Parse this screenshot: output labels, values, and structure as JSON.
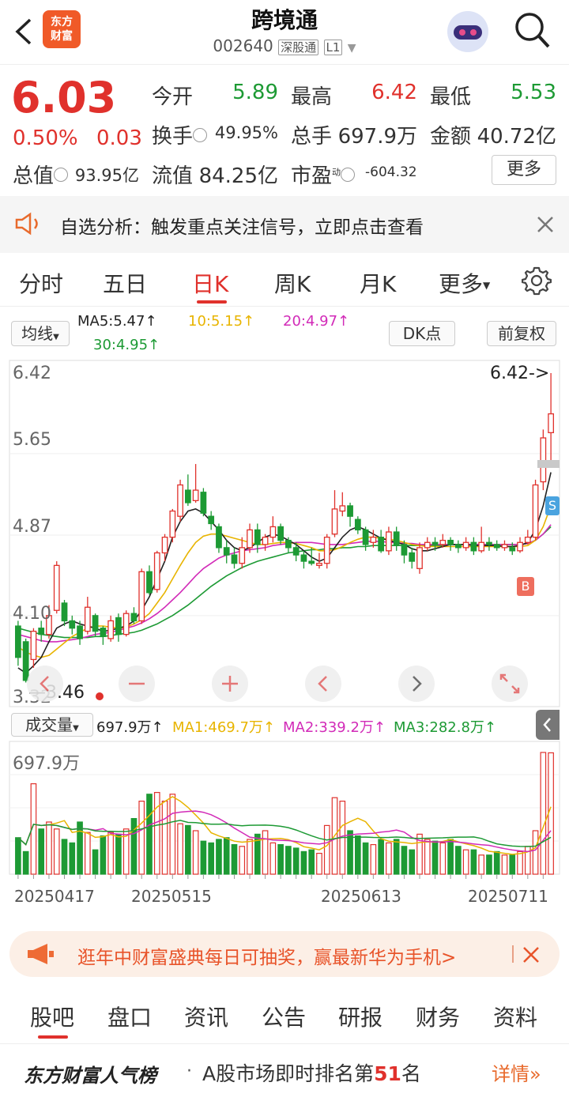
{
  "header": {
    "title": "跨境通",
    "code": "002640",
    "market_tag": "深股通",
    "level_tag": "L1",
    "logo_line1": "东方",
    "logo_line2": "财富"
  },
  "quote": {
    "price": "6.03",
    "change_pct": "0.50%",
    "change": "0.03",
    "open_label": "今开",
    "open": "5.89",
    "high_label": "最高",
    "high": "6.42",
    "low_label": "最低",
    "low": "5.53",
    "turnover_label": "换手",
    "turnover": "49.95%",
    "volume_label": "总手",
    "volume": "697.9万",
    "amount_label": "金额",
    "amount": "40.72亿",
    "mktcap_label": "总值",
    "mktcap": "93.95亿",
    "float_label": "流值",
    "float": "84.25亿",
    "pe_label": "市盈",
    "pe_sup": "动",
    "pe": "-604.32",
    "more_label": "更多"
  },
  "notice": {
    "text": "自选分析：触发重点关注信号，立即点击查看"
  },
  "tabs": {
    "items": [
      "分时",
      "五日",
      "日K",
      "周K",
      "月K",
      "更多"
    ],
    "active": "日K"
  },
  "indicators": {
    "ma_select": "均线",
    "ma5": "MA5:5.47↑",
    "ma10": "10:5.15↑",
    "ma20": "20:4.97↑",
    "ma30": "30:4.95↑",
    "dk_label": "DK点",
    "adjust_label": "前复权"
  },
  "chart_labels": {
    "y_ticks": [
      "6.42",
      "5.65",
      "4.87",
      "4.10",
      "3.32"
    ],
    "max_marker": "6.42->",
    "min_marker": "3.46",
    "buy_marker": "B",
    "sell_marker": "S",
    "vol_select": "成交量",
    "vol_value": "697.9万↑",
    "vol_ma1": "MA1:469.7万↑",
    "vol_ma2": "MA2:339.2万↑",
    "vol_ma3": "MA3:282.8万↑",
    "vol_max": "697.9万",
    "dates": [
      "20250417",
      "20250515",
      "20250613",
      "20250711"
    ]
  },
  "colors": {
    "up": "#e0312c",
    "down": "#1d9a34",
    "ma5": "#222222",
    "ma10": "#e8b400",
    "ma20": "#d22bb8",
    "ma30": "#1d9a34",
    "accent": "#e0312c"
  },
  "promo": {
    "text": "逛年中财富盛典每日可抽奖，赢最新华为手机>"
  },
  "bottom_tabs": {
    "items": [
      "股吧",
      "盘口",
      "资讯",
      "公告",
      "研报",
      "财务",
      "资料"
    ],
    "active": "股吧"
  },
  "rank": {
    "brand": "东方财富人气榜",
    "text_prefix": "A股市场即时排名第",
    "rank_no": "51",
    "text_suffix": "名",
    "detail": "详情"
  },
  "chart_data": {
    "type": "candlestick",
    "y_range": [
      3.32,
      6.42
    ],
    "candles": [
      [
        4.0,
        3.7,
        4.05,
        3.62
      ],
      [
        3.85,
        3.48,
        3.88,
        3.46
      ],
      [
        3.68,
        3.95,
        3.98,
        3.6
      ],
      [
        3.98,
        3.92,
        4.05,
        3.85
      ],
      [
        3.92,
        4.1,
        4.2,
        3.88
      ],
      [
        4.15,
        4.58,
        4.62,
        4.12
      ],
      [
        4.22,
        4.05,
        4.25,
        4.0
      ],
      [
        4.05,
        3.98,
        4.1,
        3.92
      ],
      [
        4.0,
        3.88,
        4.05,
        3.82
      ],
      [
        3.95,
        4.18,
        4.28,
        3.92
      ],
      [
        4.1,
        3.95,
        4.12,
        3.9
      ],
      [
        3.98,
        3.9,
        4.0,
        3.82
      ],
      [
        3.88,
        4.05,
        4.1,
        3.85
      ],
      [
        4.08,
        3.92,
        4.12,
        3.85
      ],
      [
        3.92,
        4.12,
        4.15,
        3.9
      ],
      [
        4.12,
        4.05,
        4.18,
        4.02
      ],
      [
        4.05,
        4.52,
        4.55,
        4.02
      ],
      [
        4.52,
        4.32,
        4.58,
        4.3
      ],
      [
        4.35,
        4.7,
        4.72,
        4.32
      ],
      [
        4.7,
        4.85,
        4.88,
        4.62
      ],
      [
        4.85,
        5.1,
        5.12,
        4.8
      ],
      [
        5.05,
        5.35,
        5.4,
        5.0
      ],
      [
        5.3,
        5.18,
        5.45,
        5.15
      ],
      [
        5.2,
        5.3,
        5.55,
        5.18
      ],
      [
        5.28,
        5.08,
        5.32,
        5.05
      ],
      [
        5.05,
        4.98,
        5.1,
        4.92
      ],
      [
        4.95,
        4.75,
        4.98,
        4.7
      ],
      [
        4.75,
        4.68,
        4.82,
        4.6
      ],
      [
        4.68,
        4.6,
        4.75,
        4.55
      ],
      [
        4.6,
        4.75,
        4.85,
        4.55
      ],
      [
        4.75,
        4.92,
        4.98,
        4.7
      ],
      [
        4.92,
        4.78,
        4.98,
        4.7
      ],
      [
        4.78,
        4.85,
        4.88,
        4.72
      ],
      [
        4.85,
        4.95,
        5.05,
        4.8
      ],
      [
        4.95,
        4.82,
        4.98,
        4.78
      ],
      [
        4.82,
        4.75,
        4.85,
        4.7
      ],
      [
        4.75,
        4.68,
        4.8,
        4.62
      ],
      [
        4.68,
        4.62,
        4.72,
        4.55
      ],
      [
        4.62,
        4.6,
        4.75,
        4.58
      ],
      [
        4.58,
        4.6,
        4.7,
        4.55
      ],
      [
        4.6,
        4.85,
        4.88,
        4.55
      ],
      [
        4.88,
        5.12,
        5.3,
        4.85
      ],
      [
        5.1,
        5.15,
        5.28,
        5.05
      ],
      [
        5.15,
        5.05,
        5.18,
        4.95
      ],
      [
        5.02,
        4.92,
        5.05,
        4.88
      ],
      [
        4.92,
        4.78,
        4.95,
        4.72
      ],
      [
        4.8,
        4.85,
        4.92,
        4.75
      ],
      [
        4.85,
        4.72,
        4.92,
        4.7
      ],
      [
        4.72,
        4.9,
        4.95,
        4.68
      ],
      [
        4.9,
        4.78,
        4.95,
        4.72
      ],
      [
        4.78,
        4.68,
        4.82,
        4.6
      ],
      [
        4.7,
        4.62,
        4.75,
        4.55
      ],
      [
        4.55,
        4.75,
        4.8,
        4.5
      ],
      [
        4.75,
        4.8,
        4.85,
        4.72
      ],
      [
        4.8,
        4.78,
        4.85,
        4.72
      ],
      [
        4.78,
        4.82,
        4.88,
        4.75
      ],
      [
        4.82,
        4.78,
        4.85,
        4.72
      ],
      [
        4.78,
        4.75,
        4.82,
        4.7
      ],
      [
        4.75,
        4.8,
        4.85,
        4.72
      ],
      [
        4.8,
        4.72,
        4.85,
        4.68
      ],
      [
        4.72,
        4.8,
        4.95,
        4.7
      ],
      [
        4.8,
        4.78,
        4.85,
        4.72
      ],
      [
        4.78,
        4.75,
        4.82,
        4.72
      ],
      [
        4.75,
        4.78,
        4.82,
        4.72
      ],
      [
        4.75,
        4.72,
        4.8,
        4.68
      ],
      [
        4.72,
        4.8,
        4.85,
        4.7
      ],
      [
        4.8,
        4.85,
        4.92,
        4.78
      ],
      [
        4.85,
        5.35,
        5.4,
        4.82
      ],
      [
        5.38,
        5.8,
        5.88,
        5.3
      ],
      [
        5.85,
        6.03,
        6.42,
        5.53
      ]
    ],
    "ma_lines": {
      "ma5": [
        3.6,
        3.55,
        3.62,
        3.7,
        3.85,
        3.98,
        4.02,
        4.05,
        4.02,
        4.0,
        3.98,
        3.95,
        3.96,
        3.98,
        4.0,
        4.05,
        4.15,
        4.28,
        4.45,
        4.62,
        4.85,
        5.0,
        5.1,
        5.12,
        5.08,
        5.0,
        4.92,
        4.82,
        4.75,
        4.72,
        4.75,
        4.8,
        4.85,
        4.88,
        4.86,
        4.82,
        4.78,
        4.72,
        4.66,
        4.62,
        4.65,
        4.75,
        4.85,
        4.92,
        4.95,
        4.92,
        4.88,
        4.84,
        4.82,
        4.8,
        4.78,
        4.74,
        4.72,
        4.72,
        4.74,
        4.76,
        4.78,
        4.78,
        4.78,
        4.77,
        4.77,
        4.77,
        4.77,
        4.76,
        4.76,
        4.77,
        4.8,
        4.92,
        5.15,
        5.47
      ],
      "ma10": [
        3.8,
        3.75,
        3.72,
        3.7,
        3.72,
        3.78,
        3.84,
        3.9,
        3.94,
        3.98,
        4.0,
        4.0,
        3.99,
        3.98,
        3.99,
        4.02,
        4.06,
        4.12,
        4.22,
        4.32,
        4.45,
        4.58,
        4.7,
        4.8,
        4.86,
        4.88,
        4.88,
        4.86,
        4.84,
        4.82,
        4.8,
        4.78,
        4.78,
        4.79,
        4.8,
        4.8,
        4.79,
        4.77,
        4.75,
        4.72,
        4.72,
        4.73,
        4.76,
        4.8,
        4.83,
        4.85,
        4.85,
        4.84,
        4.83,
        4.82,
        4.8,
        4.78,
        4.77,
        4.76,
        4.76,
        4.76,
        4.76,
        4.76,
        4.76,
        4.76,
        4.76,
        4.76,
        4.76,
        4.76,
        4.76,
        4.76,
        4.77,
        4.82,
        4.95,
        5.15
      ],
      "ma20": [
        3.92,
        3.9,
        3.88,
        3.86,
        3.85,
        3.85,
        3.86,
        3.87,
        3.88,
        3.9,
        3.92,
        3.93,
        3.94,
        3.96,
        3.98,
        4.0,
        4.03,
        4.07,
        4.12,
        4.18,
        4.25,
        4.32,
        4.4,
        4.48,
        4.55,
        4.6,
        4.65,
        4.68,
        4.7,
        4.72,
        4.73,
        4.74,
        4.75,
        4.77,
        4.78,
        4.79,
        4.8,
        4.8,
        4.8,
        4.79,
        4.78,
        4.78,
        4.78,
        4.79,
        4.8,
        4.81,
        4.81,
        4.81,
        4.8,
        4.8,
        4.79,
        4.79,
        4.78,
        4.78,
        4.78,
        4.78,
        4.78,
        4.78,
        4.78,
        4.78,
        4.78,
        4.78,
        4.78,
        4.78,
        4.78,
        4.78,
        4.79,
        4.82,
        4.88,
        4.97
      ],
      "ma30": [
        3.98,
        3.96,
        3.94,
        3.92,
        3.91,
        3.9,
        3.89,
        3.89,
        3.89,
        3.89,
        3.9,
        3.9,
        3.91,
        3.92,
        3.93,
        3.94,
        3.96,
        3.99,
        4.02,
        4.06,
        4.1,
        4.15,
        4.2,
        4.26,
        4.32,
        4.38,
        4.43,
        4.48,
        4.52,
        4.56,
        4.59,
        4.62,
        4.64,
        4.66,
        4.68,
        4.7,
        4.71,
        4.72,
        4.73,
        4.73,
        4.74,
        4.74,
        4.75,
        4.75,
        4.76,
        4.76,
        4.77,
        4.77,
        4.77,
        4.77,
        4.77,
        4.77,
        4.77,
        4.77,
        4.77,
        4.77,
        4.78,
        4.78,
        4.78,
        4.78,
        4.78,
        4.78,
        4.78,
        4.78,
        4.78,
        4.78,
        4.79,
        4.82,
        4.88,
        4.95
      ]
    },
    "volume": [
      210,
      130,
      520,
      260,
      300,
      260,
      200,
      180,
      300,
      240,
      140,
      220,
      240,
      230,
      260,
      320,
      420,
      460,
      470,
      420,
      460,
      290,
      280,
      250,
      190,
      180,
      200,
      210,
      170,
      160,
      200,
      230,
      250,
      180,
      170,
      160,
      150,
      130,
      140,
      120,
      280,
      440,
      420,
      250,
      220,
      180,
      170,
      200,
      180,
      200,
      160,
      140,
      230,
      200,
      190,
      180,
      200,
      160,
      140,
      140,
      110,
      110,
      130,
      110,
      110,
      130,
      160,
      250,
      700,
      697.9
    ],
    "volume_max": 700
  }
}
